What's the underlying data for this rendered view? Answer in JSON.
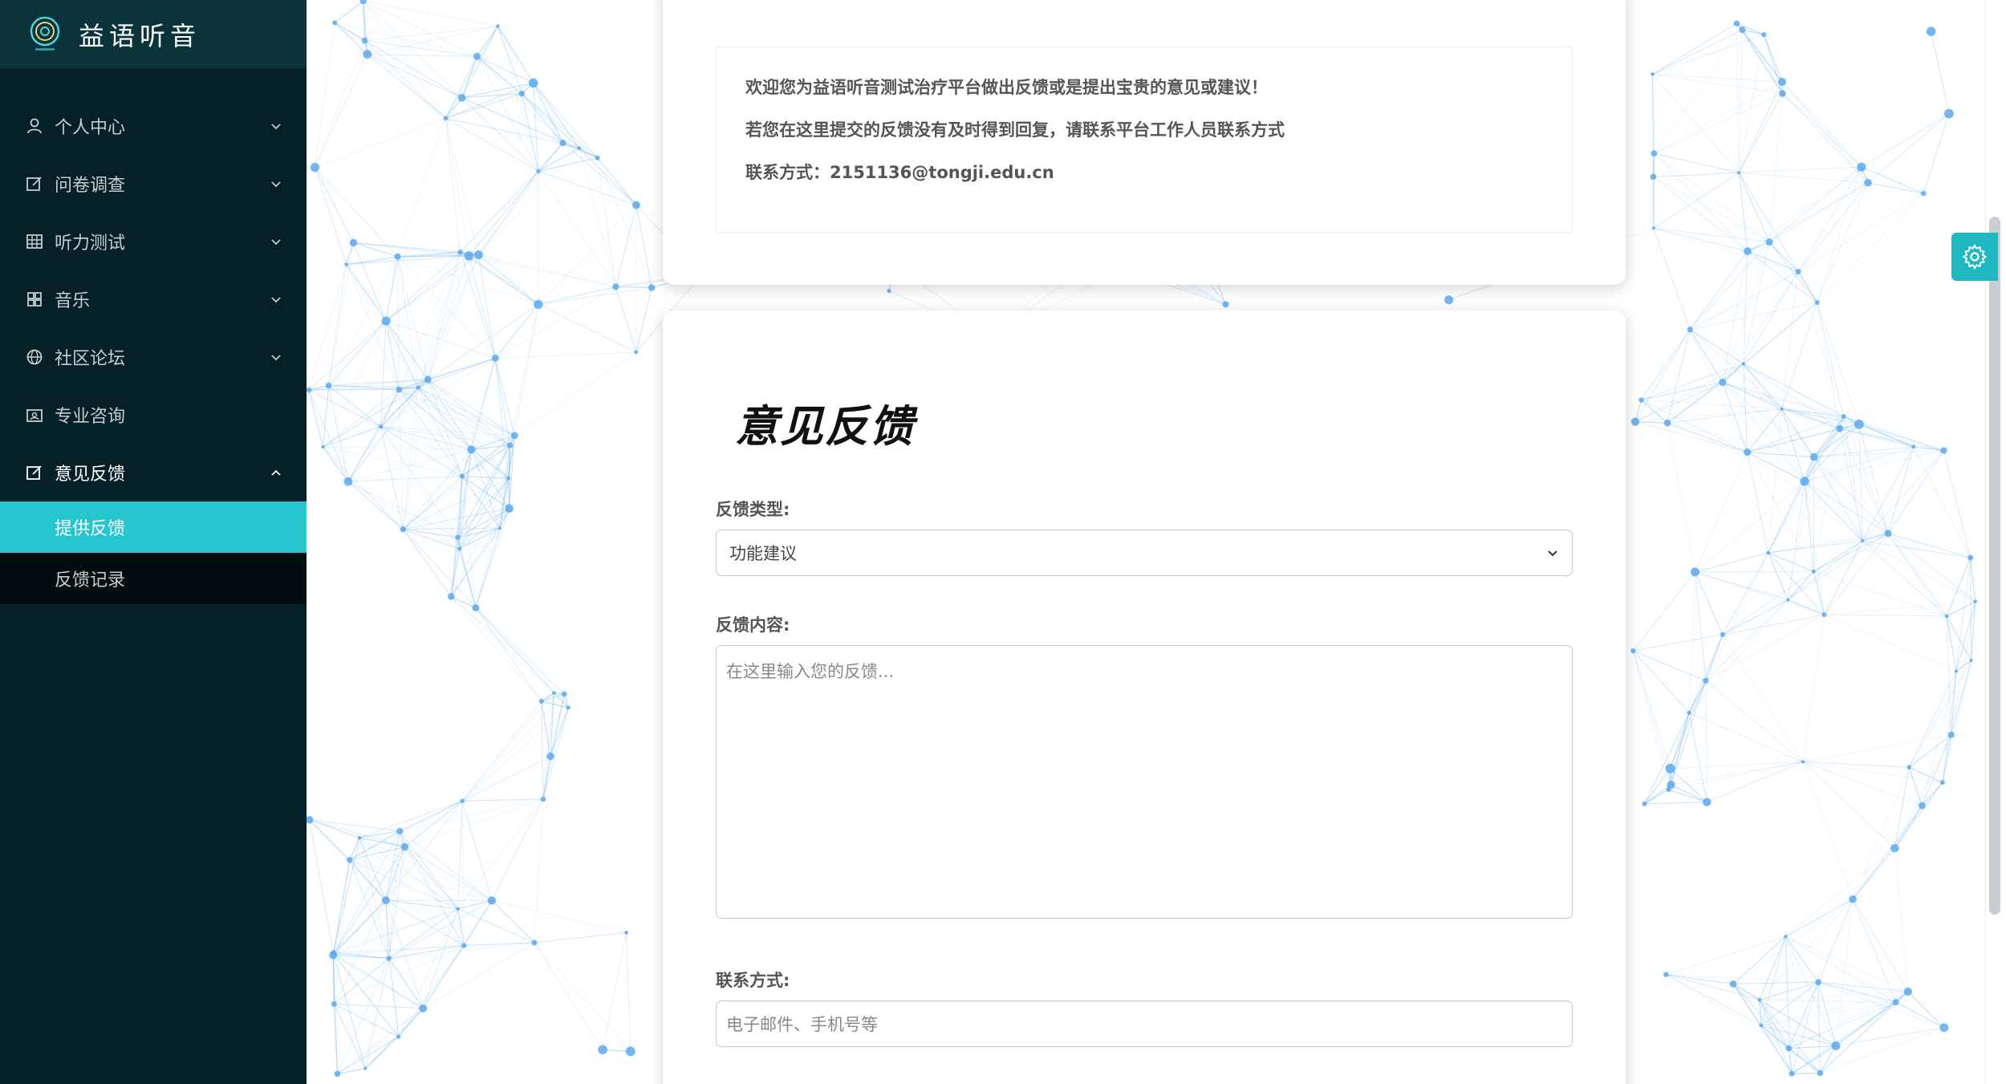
{
  "app": {
    "title": "益语听音"
  },
  "sidebar": {
    "items": [
      {
        "label": "个人中心",
        "icon": "user-icon"
      },
      {
        "label": "问卷调查",
        "icon": "edit-icon"
      },
      {
        "label": "听力测试",
        "icon": "table-icon"
      },
      {
        "label": "音乐",
        "icon": "grid-icon"
      },
      {
        "label": "社区论坛",
        "icon": "globe-icon"
      },
      {
        "label": "专业咨询",
        "icon": "consult-icon"
      },
      {
        "label": "意见反馈",
        "icon": "edit-icon"
      }
    ],
    "feedback_sub": [
      {
        "label": "提供反馈"
      },
      {
        "label": "反馈记录"
      }
    ]
  },
  "info": {
    "line1": "欢迎您为益语听音测试治疗平台做出反馈或是提出宝贵的意见或建议！",
    "line2": "若您在这里提交的反馈没有及时得到回复，请联系平台工作人员联系方式",
    "line3": "联系方式：2151136@tongji.edu.cn"
  },
  "form": {
    "title": "意见反馈",
    "type_label": "反馈类型:",
    "type_value": "功能建议",
    "content_label": "反馈内容:",
    "content_placeholder": "在这里输入您的反馈...",
    "contact_label": "联系方式:",
    "contact_placeholder": "电子邮件、手机号等"
  },
  "colors": {
    "sidebar_bg": "#052026",
    "brand_bg": "#0a3439",
    "active_item": "#25c6cf",
    "settings_button": "#1fb8c2",
    "network_lines": "#8ec5f5"
  }
}
